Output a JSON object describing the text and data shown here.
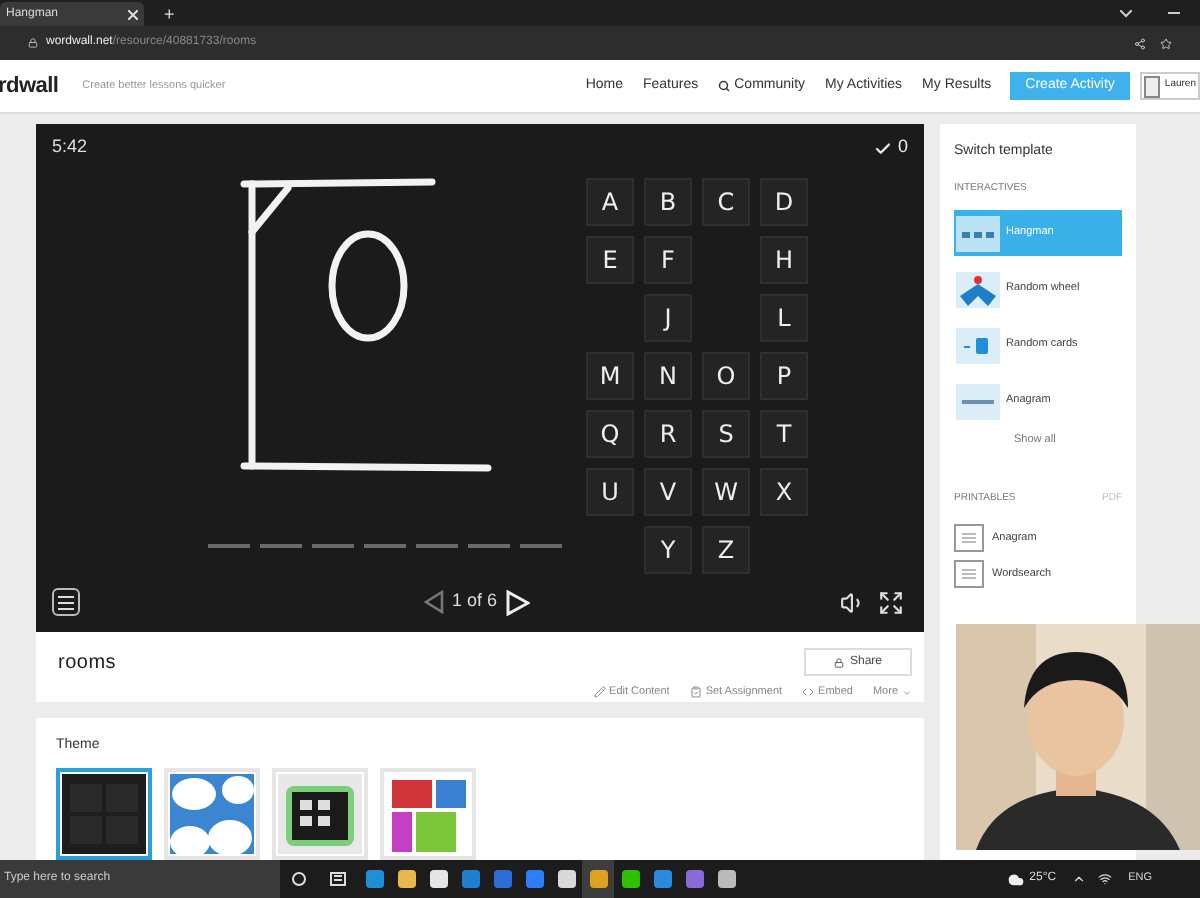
{
  "browser": {
    "tabs": [
      {
        "title": "Hangman",
        "selected": true
      }
    ],
    "new_tab": "+",
    "url_domain": "wordwall.net",
    "url_path": "/resource/40881733/rooms"
  },
  "header": {
    "logo": "rdwall",
    "tagline": "Create better lessons quicker",
    "nav": [
      {
        "label": "Home",
        "kind": "link"
      },
      {
        "label": "Features",
        "kind": "link"
      },
      {
        "label": "Community",
        "kind": "search"
      },
      {
        "label": "My Activities",
        "kind": "link"
      },
      {
        "label": "My Results",
        "kind": "link"
      }
    ],
    "cta": "Create Activity",
    "user": "Lauren"
  },
  "game": {
    "timer": "5:42",
    "score": "0",
    "page": "1 of 6",
    "word_slots": [
      {
        "filled": false
      },
      {
        "filled": false
      },
      {
        "filled": false
      },
      {
        "filled": false
      },
      {
        "filled": false
      },
      {
        "filled": false
      },
      {
        "filled": false
      }
    ],
    "keys": [
      {
        "kind": "key",
        "letter": "A"
      },
      {
        "kind": "key",
        "letter": "B"
      },
      {
        "kind": "key",
        "letter": "C"
      },
      {
        "kind": "key",
        "letter": "D"
      },
      {
        "kind": "key",
        "letter": "E"
      },
      {
        "kind": "key",
        "letter": "F"
      },
      {
        "kind": "gap"
      },
      {
        "kind": "key",
        "letter": "H"
      },
      {
        "kind": "gap"
      },
      {
        "kind": "key",
        "letter": "J"
      },
      {
        "kind": "gap"
      },
      {
        "kind": "key",
        "letter": "L"
      },
      {
        "kind": "key",
        "letter": "M"
      },
      {
        "kind": "key",
        "letter": "N"
      },
      {
        "kind": "key",
        "letter": "O"
      },
      {
        "kind": "key",
        "letter": "P"
      },
      {
        "kind": "key",
        "letter": "Q"
      },
      {
        "kind": "key",
        "letter": "R"
      },
      {
        "kind": "key",
        "letter": "S"
      },
      {
        "kind": "key",
        "letter": "T"
      },
      {
        "kind": "key",
        "letter": "U"
      },
      {
        "kind": "key",
        "letter": "V"
      },
      {
        "kind": "key",
        "letter": "W"
      },
      {
        "kind": "key",
        "letter": "X"
      },
      {
        "kind": "gap"
      },
      {
        "kind": "key",
        "letter": "Y"
      },
      {
        "kind": "key",
        "letter": "Z"
      },
      {
        "kind": "gap"
      }
    ]
  },
  "activity": {
    "title": "rooms",
    "share": "Share",
    "actions": [
      {
        "label": "Edit Content",
        "kind": "edit"
      },
      {
        "label": "Set Assignment",
        "kind": "assign"
      },
      {
        "label": "Embed",
        "kind": "embed"
      },
      {
        "label": "More",
        "kind": "more"
      }
    ]
  },
  "theme": {
    "title": "Theme",
    "options": [
      {
        "kind": "chalk",
        "selected": true
      },
      {
        "kind": "clouds",
        "selected": false
      },
      {
        "kind": "arcade",
        "selected": false
      },
      {
        "kind": "tiles",
        "selected": false
      }
    ]
  },
  "sidebar": {
    "title": "Switch template",
    "interactives_heading": "INTERACTIVES",
    "interactives": [
      {
        "label": "Hangman",
        "kind": "hangman",
        "selected": true
      },
      {
        "label": "Random wheel",
        "kind": "wheel",
        "selected": false
      },
      {
        "label": "Random cards",
        "kind": "cards",
        "selected": false
      },
      {
        "label": "Anagram",
        "kind": "anagram",
        "selected": false
      }
    ],
    "show_all": "Show all",
    "printables_heading": "PRINTABLES",
    "printables_format": "PDF",
    "printables": [
      {
        "label": "Anagram"
      },
      {
        "label": "Wordsearch"
      }
    ]
  },
  "taskbar": {
    "search_placeholder": "Type here to search",
    "apps": [
      {
        "color": "#1e90d6",
        "selected": false
      },
      {
        "color": "#e8b84a",
        "selected": false
      },
      {
        "color": "#e6e6e6",
        "selected": false
      },
      {
        "color": "#1f7fd0",
        "selected": false
      },
      {
        "color": "#2b6fd6",
        "selected": false
      },
      {
        "color": "#2d7ff9",
        "selected": false
      },
      {
        "color": "#d9d9d9",
        "selected": false
      },
      {
        "color": "#e0a020",
        "selected": true
      },
      {
        "color": "#2dc100",
        "selected": false
      },
      {
        "color": "#2a8ae0",
        "selected": false
      },
      {
        "color": "#8a6ad8",
        "selected": false
      },
      {
        "color": "#bbbbbb",
        "selected": false
      }
    ],
    "weather": "25°C",
    "language": "ENG"
  }
}
